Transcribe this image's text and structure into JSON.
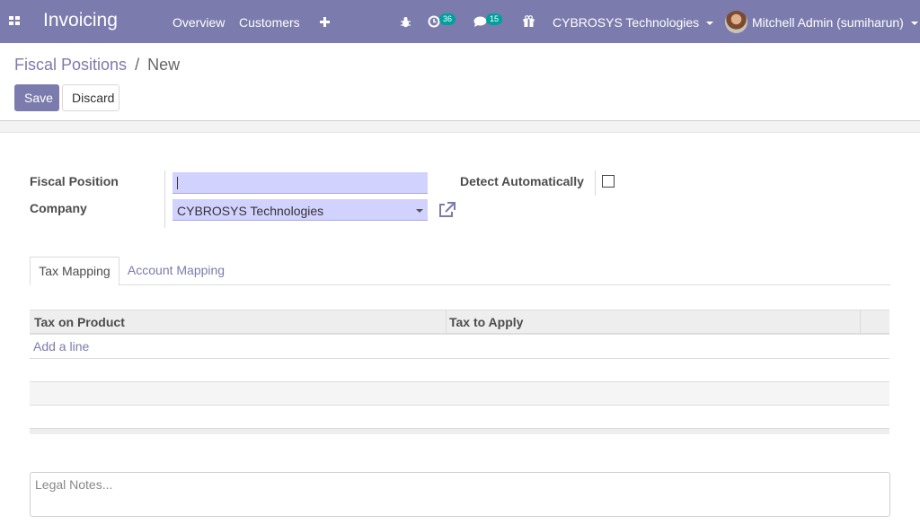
{
  "navbar": {
    "app_title": "Invoicing",
    "menu": [
      "Overview",
      "Customers"
    ],
    "activity_count": "36",
    "messages_count": "15",
    "company": "CYBROSYS Technologies",
    "user": "Mitchell Admin (sumiharun)",
    "icons": [
      "apps-icon",
      "plus-icon",
      "bug-icon",
      "clock-icon",
      "chat-icon",
      "gift-icon",
      "caret-down-icon"
    ],
    "bg_color": "#7c7bad",
    "badge_color": "#00a09d"
  },
  "breadcrumb": {
    "parent": "Fiscal Positions",
    "separator": "/",
    "current": "New"
  },
  "buttons": {
    "save": "Save",
    "discard": "Discard"
  },
  "form": {
    "fiscal_position_label": "Fiscal Position",
    "fiscal_position_value": "",
    "company_label": "Company",
    "company_value": "CYBROSYS Technologies",
    "detect_label": "Detect Automatically",
    "detect_checked": false,
    "input_color": "#d2d2ff"
  },
  "tabs": [
    {
      "label": "Tax Mapping",
      "active": true
    },
    {
      "label": "Account Mapping",
      "active": false
    }
  ],
  "table": {
    "columns": [
      "Tax on Product",
      "Tax to Apply"
    ],
    "add_line": "Add a line"
  },
  "notes": {
    "placeholder": "Legal Notes..."
  }
}
